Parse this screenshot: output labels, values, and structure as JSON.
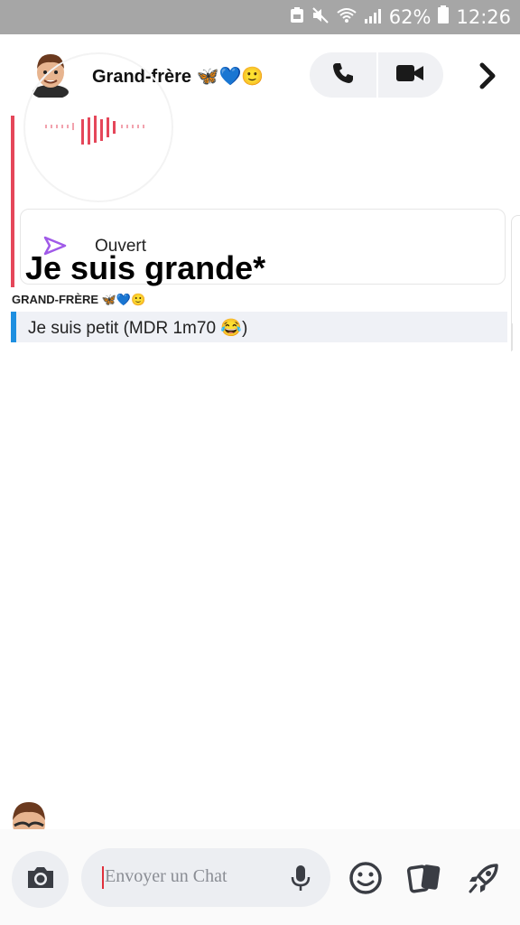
{
  "status_bar": {
    "battery_pct": "62%",
    "time": "12:26"
  },
  "header": {
    "contact_name": "Grand-frère 🦋💙🙂"
  },
  "chat": {
    "opened_label": "Ouvert",
    "big_caption": "Je suis grande*",
    "sender_label": "GRAND-FRÈRE 🦋💙🙂",
    "message_text": "Je suis petit (MDR 1m70 😂)"
  },
  "composer": {
    "placeholder": "Envoyer un Chat"
  },
  "colors": {
    "audio_red": "#e5475a",
    "message_blue": "#1e8fe0",
    "opened_purple": "#a05ae8",
    "caret_red": "#e0303c"
  }
}
